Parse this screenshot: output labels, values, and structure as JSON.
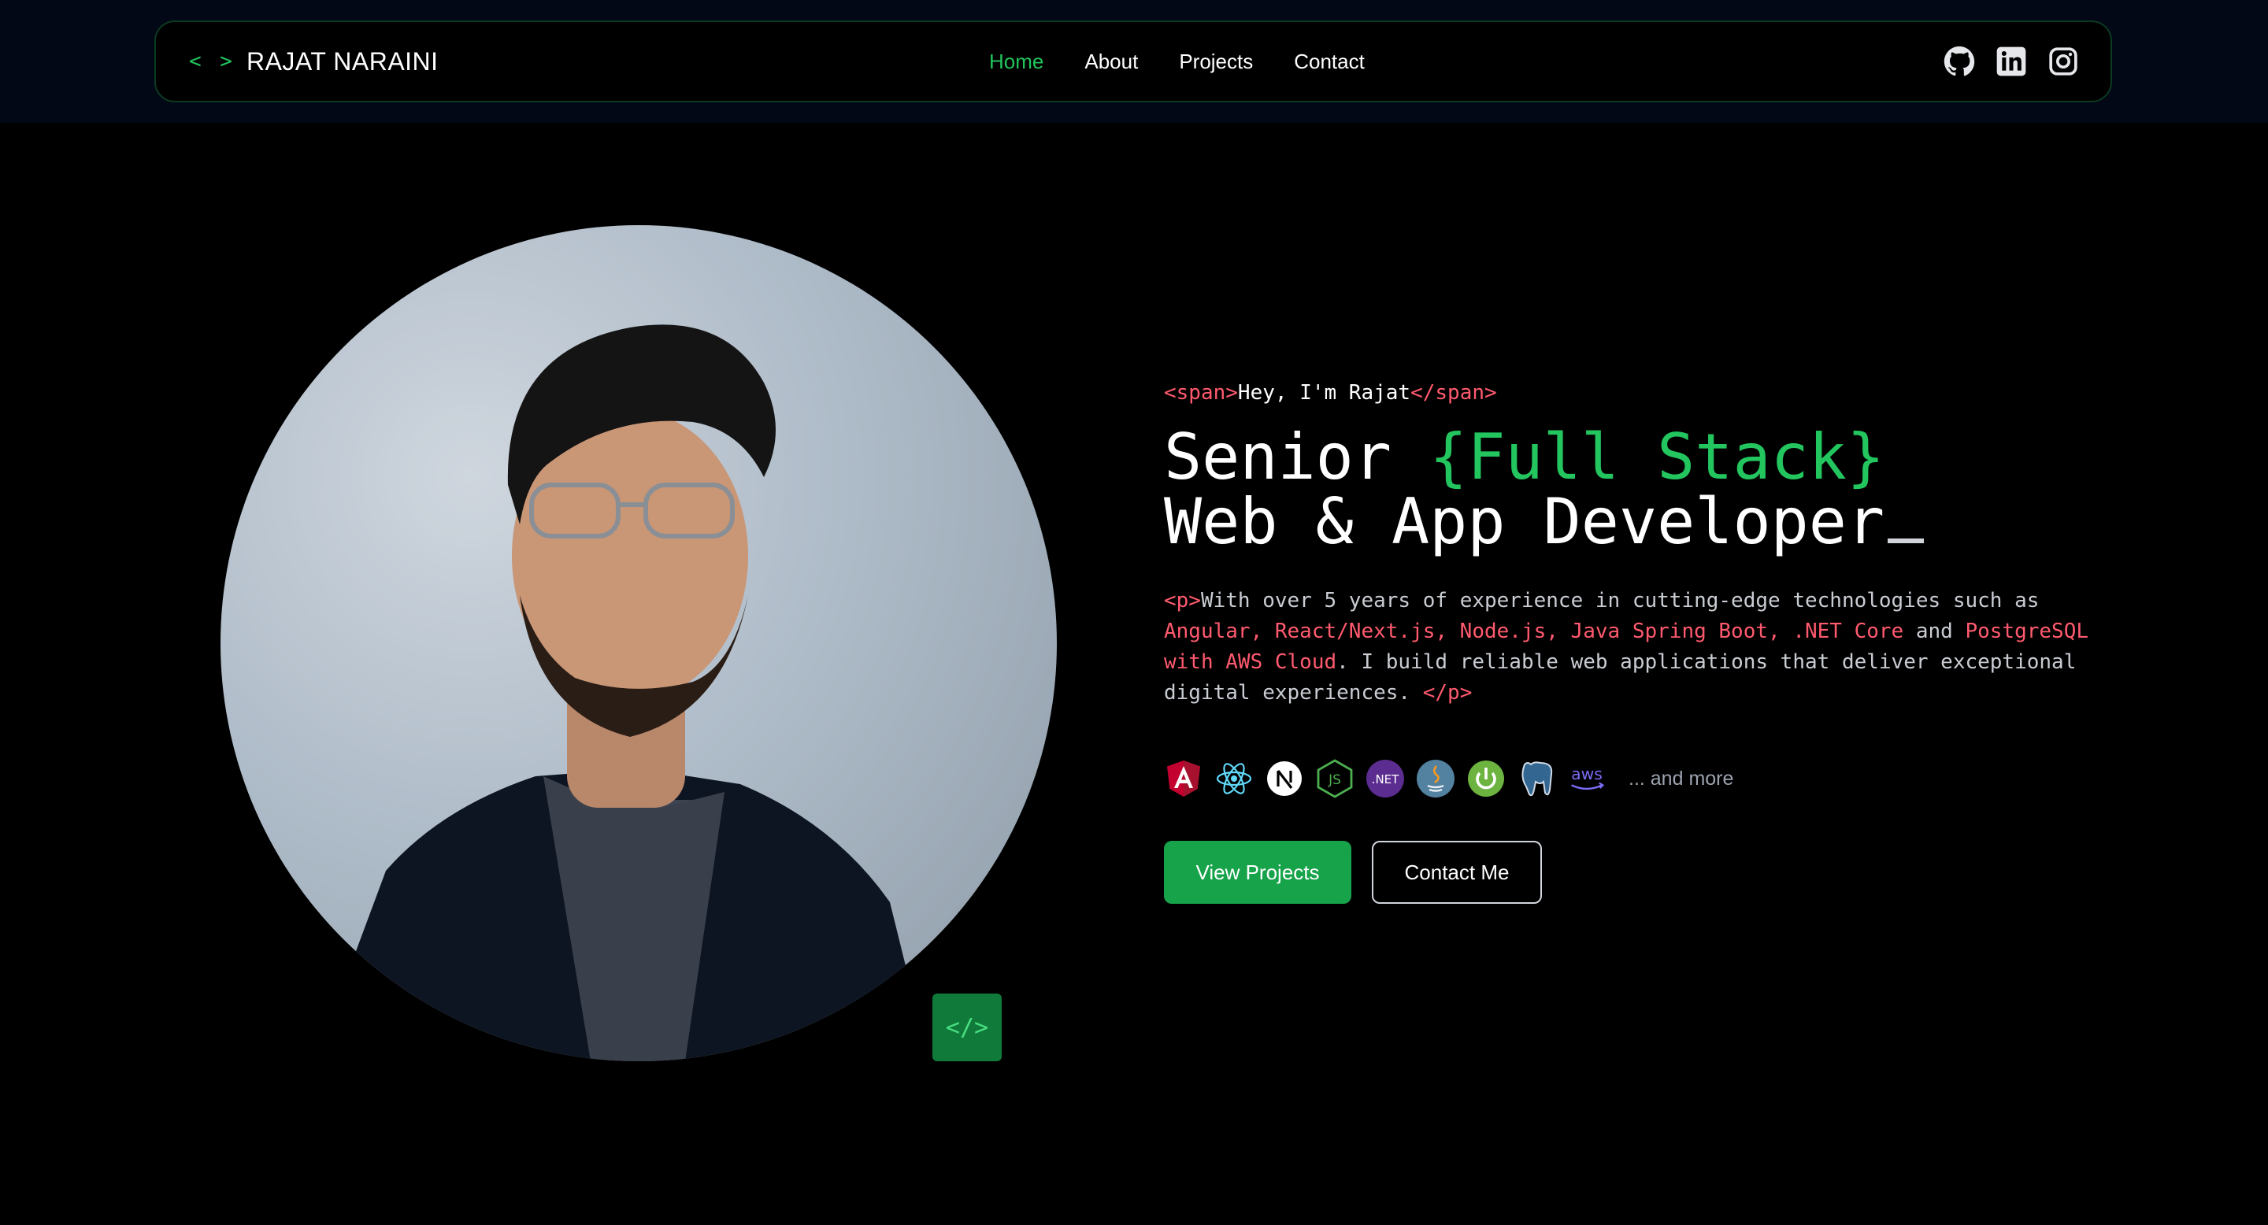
{
  "nav": {
    "brand_icon": "< >",
    "brand_name": "RAJAT NARAINI",
    "links": [
      "Home",
      "About",
      "Projects",
      "Contact"
    ],
    "active": "Home",
    "socials": [
      "github-icon",
      "linkedin-icon",
      "instagram-icon"
    ]
  },
  "hero": {
    "intro_open": "<span>",
    "intro_text": "Hey, I'm Rajat",
    "intro_close": "</span>",
    "title_line1_prefix": "Senior ",
    "title_line1_highlight": "{Full Stack}",
    "title_line2": "Web & App Developer",
    "desc_open": "<p>",
    "desc_text1": "With over 5 years of experience in cutting-edge technologies such as ",
    "desc_tech1": "Angular, React/Next.js, Node.js, Java Spring Boot, .NET Core",
    "desc_and": " and ",
    "desc_tech2": "PostgreSQL with AWS Cloud",
    "desc_text2": ". I build reliable web applications that deliver exceptional digital experiences. ",
    "desc_close": "</p>",
    "tech_icons": [
      "angular-icon",
      "react-icon",
      "nextjs-icon",
      "nodejs-icon",
      "dotnet-icon",
      "java-icon",
      "spring-boot-icon",
      "postgresql-icon",
      "aws-icon"
    ],
    "dotnet_label": ".NET",
    "aws_label": "aws",
    "tech_more": "... and more",
    "primary_button": "View Projects",
    "secondary_button": "Contact Me",
    "code_badge": "</>"
  },
  "colors": {
    "accent": "#22c55e",
    "tag": "#ff5a6e",
    "background": "#000000"
  }
}
